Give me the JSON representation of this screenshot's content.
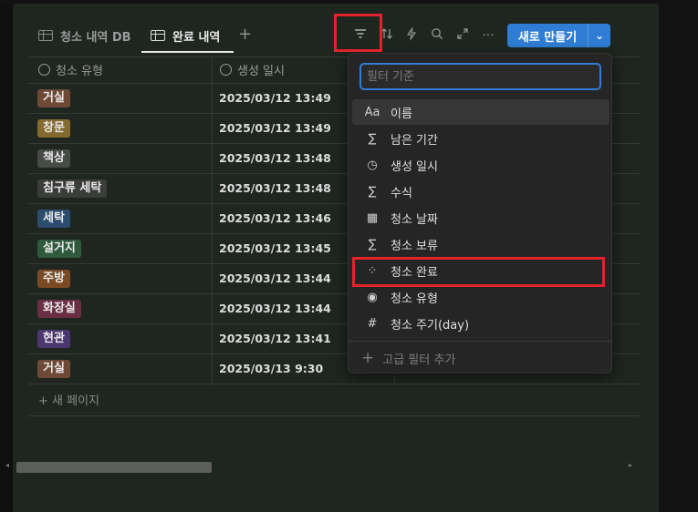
{
  "tabs": [
    {
      "label": "청소 내역 DB",
      "active": false
    },
    {
      "label": "완료 내역",
      "active": true
    }
  ],
  "add_tab_label": "+",
  "toolbar": {
    "filter_icon": "filter-icon",
    "sort_icon": "sort-icon",
    "automation_icon": "lightning-icon",
    "search_icon": "search-icon",
    "expand_icon": "expand-icon",
    "more_label": "···",
    "new_button_label": "새로 만들기",
    "new_button_arrow": "⌄",
    "accent_color": "#2f7dd4"
  },
  "table": {
    "columns": [
      "청소 유형",
      "생성 일시"
    ],
    "rows": [
      {
        "type": "거실",
        "color": "#6e4a36",
        "created": "2025/03/12 13:49"
      },
      {
        "type": "창문",
        "color": "#846a2f",
        "created": "2025/03/12 13:49"
      },
      {
        "type": "책상",
        "color": "#474a47",
        "created": "2025/03/12 13:48"
      },
      {
        "type": "침구류 세탁",
        "color": "#3a3d3a",
        "created": "2025/03/12 13:48"
      },
      {
        "type": "세탁",
        "color": "#2d4d6e",
        "created": "2025/03/12 13:46"
      },
      {
        "type": "설거지",
        "color": "#2f5a3e",
        "created": "2025/03/12 13:45"
      },
      {
        "type": "주방",
        "color": "#7a4a24",
        "created": "2025/03/12 13:44"
      },
      {
        "type": "화장실",
        "color": "#6b2f45",
        "created": "2025/03/12 13:44"
      },
      {
        "type": "현관",
        "color": "#4c3670",
        "created": "2025/03/12 13:41"
      },
      {
        "type": "거실",
        "color": "#6e4a36",
        "created": "2025/03/13 9:30"
      }
    ],
    "new_page_label": "+ 새 페이지"
  },
  "filter_popup": {
    "search_placeholder": "필터 기준",
    "items": [
      {
        "icon": "Aa",
        "label": "이름",
        "hovered": true
      },
      {
        "icon": "∑",
        "label": "남은 기간"
      },
      {
        "icon": "◷",
        "label": "생성 일시"
      },
      {
        "icon": "∑",
        "label": "수식"
      },
      {
        "icon": "▦",
        "label": "청소 날짜"
      },
      {
        "icon": "∑",
        "label": "청소 보류"
      },
      {
        "icon": "⁘",
        "label": "청소 완료",
        "highlighted": true
      },
      {
        "icon": "◉",
        "label": "청소 유형"
      },
      {
        "icon": "#",
        "label": "청소 주기(day)"
      }
    ],
    "advanced_label": "고급 필터 추가"
  }
}
